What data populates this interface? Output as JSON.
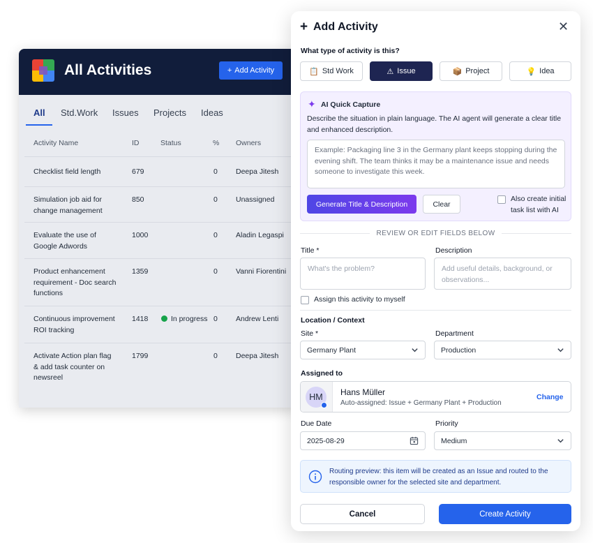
{
  "app": {
    "title": "All Activities",
    "add_button": "Add Activity",
    "tabs": [
      "All",
      "Std.Work",
      "Issues",
      "Projects",
      "Ideas"
    ],
    "columns": [
      "Activity Name",
      "ID",
      "Status",
      "%",
      "Owners"
    ],
    "rows": [
      {
        "name": "Checklist field length",
        "id": "679",
        "status": "",
        "pct": "0",
        "owner": "Deepa Jitesh"
      },
      {
        "name": "Simulation job aid for change management",
        "id": "850",
        "status": "",
        "pct": "0",
        "owner": "Unassigned"
      },
      {
        "name": "Evaluate the use of Google Adwords",
        "id": "1000",
        "status": "",
        "pct": "0",
        "owner": "Aladin Legaspi"
      },
      {
        "name": "Product enhancement requirement - Doc search functions",
        "id": "1359",
        "status": "",
        "pct": "0",
        "owner": "Vanni Fiorentini"
      },
      {
        "name": "Continuous improvement ROI tracking",
        "id": "1418",
        "status": "In progress",
        "pct": "0",
        "owner": "Andrew Lenti"
      },
      {
        "name": "Activate Action plan flag & add task counter on newsreel",
        "id": "1799",
        "status": "",
        "pct": "0",
        "owner": "Deepa Jitesh"
      }
    ]
  },
  "modal": {
    "title": "Add Activity",
    "type_question": "What type of activity is this?",
    "types": [
      {
        "label": "Std Work",
        "icon": "clipboard-icon",
        "glyph": "📋"
      },
      {
        "label": "Issue",
        "icon": "warning-icon",
        "glyph": "⚠"
      },
      {
        "label": "Project",
        "icon": "package-icon",
        "glyph": "📦"
      },
      {
        "label": "Idea",
        "icon": "lightbulb-icon",
        "glyph": "💡"
      }
    ],
    "selected_type": "Issue",
    "ai": {
      "title": "AI Quick Capture",
      "description": "Describe the situation in plain language. The AI agent will generate a clear title and enhanced description.",
      "placeholder": "Example: Packaging line 3 in the Germany plant keeps stopping during the evening shift. The team thinks it may be a maintenance issue and needs someone to investigate this week.",
      "generate_label": "Generate Title & Description",
      "clear_label": "Clear",
      "tasklist_label": "Also create initial task list with AI"
    },
    "divider": "REVIEW OR EDIT FIELDS BELOW",
    "title_label": "Title *",
    "title_placeholder": "What's the problem?",
    "description_label": "Description",
    "description_placeholder": "Add useful details, background, or observations...",
    "assign_self_label": "Assign this activity to myself",
    "location_heading": "Location / Context",
    "site_label": "Site *",
    "site_value": "Germany Plant",
    "department_label": "Department",
    "department_value": "Production",
    "assigned_heading": "Assigned to",
    "assignee": {
      "initials": "HM",
      "name": "Hans Müller",
      "detail": "Auto-assigned: Issue + Germany Plant + Production",
      "change_label": "Change"
    },
    "due_date_label": "Due Date",
    "due_date_value": "2025-08-29",
    "priority_label": "Priority",
    "priority_value": "Medium",
    "routing_text": "Routing preview: this item will be created as an Issue and routed to the responsible owner for the selected site and department.",
    "cancel_label": "Cancel",
    "create_label": "Create Activity"
  },
  "colors": {
    "header_navy": "#111d3b",
    "primary_blue": "#2563eb",
    "selected_type": "#1e2552",
    "ai_purple": "#7c3aed",
    "ai_bg": "#f4f0ff",
    "status_green": "#16a34a"
  }
}
